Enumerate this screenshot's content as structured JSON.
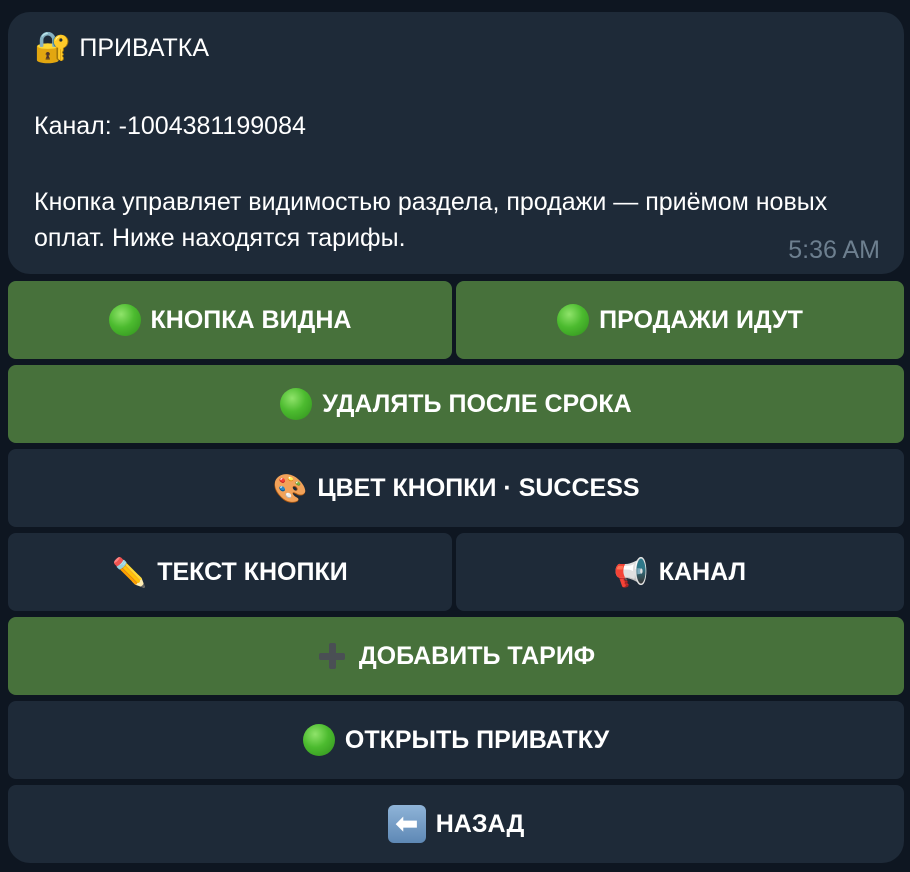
{
  "message": {
    "title_emoji": "🔐",
    "title": "ПРИВАТКА",
    "channel_line": "Канал: -1004381199084",
    "description": "Кнопка управляет видимостью раздела, продажи — приёмом новых оплат. Ниже находятся тарифы.",
    "time": "5:36 AM"
  },
  "keyboard": {
    "button_visible": "КНОПКА ВИДНА",
    "sales_on": "ПРОДАЖИ ИДУТ",
    "delete_after_term": "УДАЛЯТЬ ПОСЛЕ СРОКА",
    "button_color": "ЦВЕТ КНОПКИ · SUCCESS",
    "button_color_emoji": "🎨",
    "button_text": "ТЕКСТ КНОПКИ",
    "button_text_emoji": "✏️",
    "channel": "КАНАЛ",
    "channel_emoji": "📢",
    "add_tariff": "ДОБАВИТЬ ТАРИФ",
    "open_private": "ОТКРЫТЬ ПРИВАТКУ",
    "back": "НАЗАД",
    "back_emoji": "⬅"
  },
  "colors": {
    "background": "#0e1621",
    "bubble": "#1e2a38",
    "green_button": "#47713b",
    "dark_button": "#1e2a38",
    "timestamp": "#6d7f8f"
  }
}
